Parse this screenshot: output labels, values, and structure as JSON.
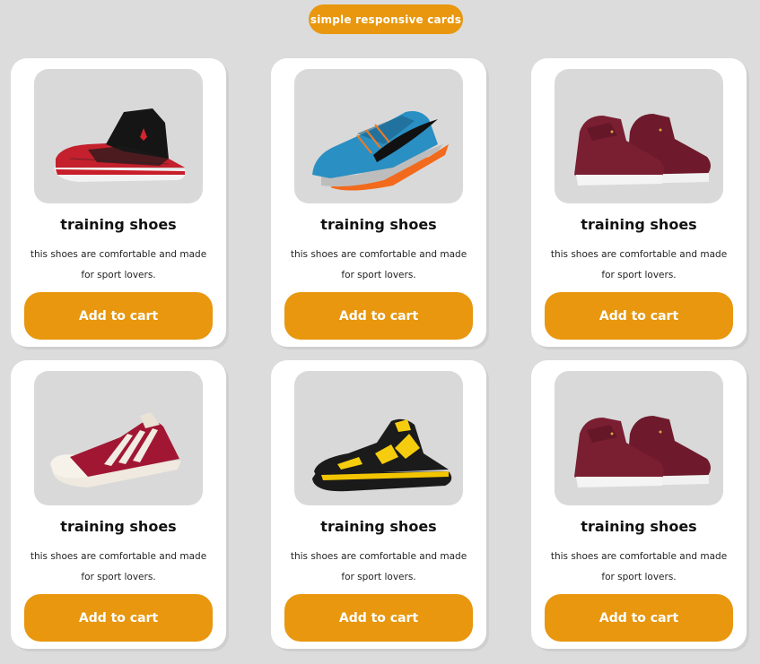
{
  "header": {
    "title": "simple responsive cards"
  },
  "cards": [
    {
      "image": "black-red-basketball-shoe",
      "title": "training shoes",
      "description": "this shoes are comfortable and made for sport lovers.",
      "button": "Add to cart"
    },
    {
      "image": "blue-orange-running-shoe",
      "title": "training shoes",
      "description": "this shoes are comfortable and made for sport lovers.",
      "button": "Add to cart"
    },
    {
      "image": "maroon-velvet-high-top-shoes",
      "title": "training shoes",
      "description": "this shoes are comfortable and made for sport lovers.",
      "button": "Add to cart"
    },
    {
      "image": "red-white-stripe-sneaker",
      "title": "training shoes",
      "description": "this shoes are comfortable and made for sport lovers.",
      "button": "Add to cart"
    },
    {
      "image": "black-yellow-high-top-shoe",
      "title": "training shoes",
      "description": "this shoes are comfortable and made for sport lovers.",
      "button": "Add to cart"
    },
    {
      "image": "maroon-velvet-high-top-shoes",
      "title": "training shoes",
      "description": "this shoes are comfortable and made for sport lovers.",
      "button": "Add to cart"
    }
  ],
  "colors": {
    "accent": "#e8970e",
    "background": "#dcdcdc",
    "card": "#ffffff",
    "image_bg": "#d9d9d9"
  }
}
